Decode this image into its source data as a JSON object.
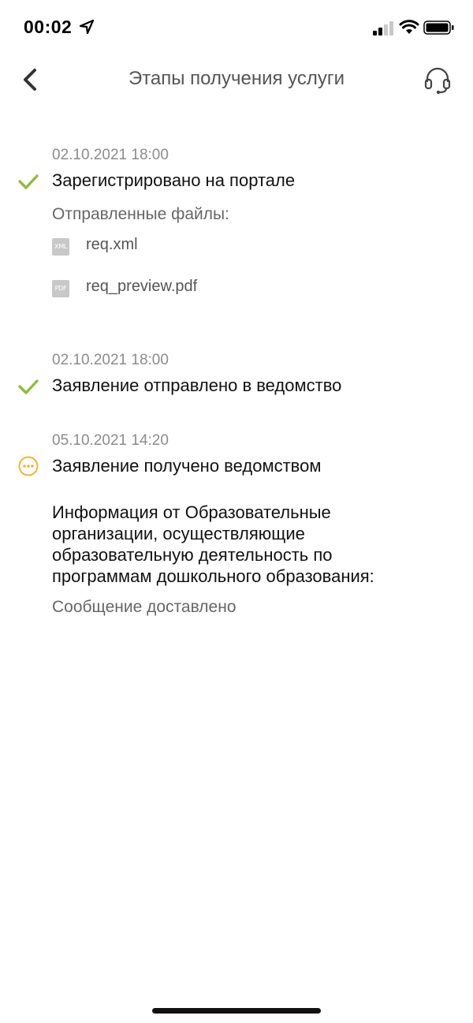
{
  "status_bar": {
    "time": "00:02",
    "icons": [
      "location-arrow-icon",
      "cellular-signal-icon",
      "wifi-icon",
      "battery-icon"
    ]
  },
  "nav": {
    "title": "Этапы получения услуги",
    "back_icon": "chevron-left-icon",
    "support_icon": "headset-icon"
  },
  "stages": [
    {
      "date": "02.10.2021 18:00",
      "title": "Зарегистрировано на портале",
      "status_icon": "check-icon",
      "files_label": "Отправленные файлы:",
      "files": [
        {
          "badge": "XML",
          "name": "req.xml"
        },
        {
          "badge": "PDF",
          "name": "req_preview.pdf"
        }
      ]
    },
    {
      "date": "02.10.2021 18:00",
      "title": "Заявление отправлено в ведомство",
      "status_icon": "check-icon"
    },
    {
      "date": "05.10.2021 14:20",
      "title": "Заявление получено ведомством",
      "status_icon": "pending-dots-icon",
      "info_lines": [
        "Информация от Образовательные",
        "организации, осуществляющие",
        "образовательную деятельность по",
        "программам дошкольного образования:"
      ],
      "info_status": "Сообщение доставлено"
    }
  ],
  "colors": {
    "check": "#8fbd3c",
    "pending": "#f0b43c",
    "title": "#555555",
    "date": "#8c8c8c"
  }
}
